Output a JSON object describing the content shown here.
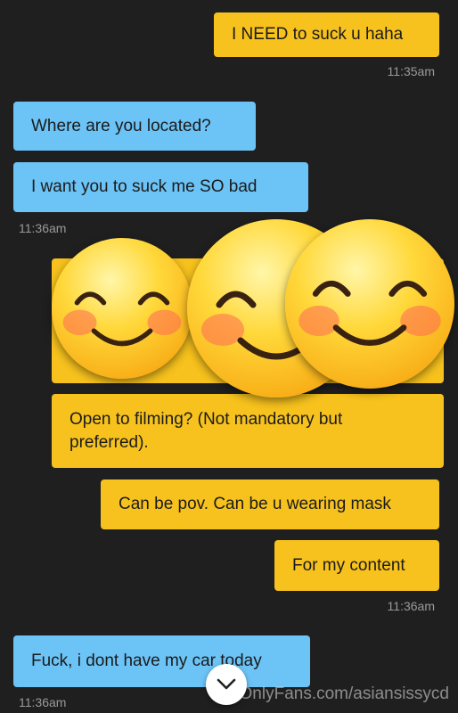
{
  "messages": [
    {
      "text": "I NEED to suck u haha",
      "side": "sent"
    },
    {
      "text": "Where are you located?",
      "side": "received"
    },
    {
      "text": "I want you to suck me SO bad",
      "side": "received"
    },
    {
      "text": "Open to filming? (Not mandatory but preferred).",
      "side": "sent"
    },
    {
      "text": "Can be pov. Can be u wearing mask",
      "side": "sent"
    },
    {
      "text": "For my content",
      "side": "sent"
    },
    {
      "text": "Fuck, i dont have my car today",
      "side": "received"
    }
  ],
  "timestamps": [
    "11:35am",
    "11:36am",
    "11:36am",
    "11:36am"
  ],
  "overlay": {
    "icon": "blushing-smile-emoji-icon",
    "count": 3
  },
  "watermark": "OnlyFans.com/asiansissycd",
  "scroll_button": {
    "icon": "chevron-down-icon"
  },
  "colors": {
    "background": "#1f1f1f",
    "sent_bubble": "#f7c21d",
    "received_bubble": "#6cc3f5",
    "timestamp": "#9a9a9a"
  }
}
